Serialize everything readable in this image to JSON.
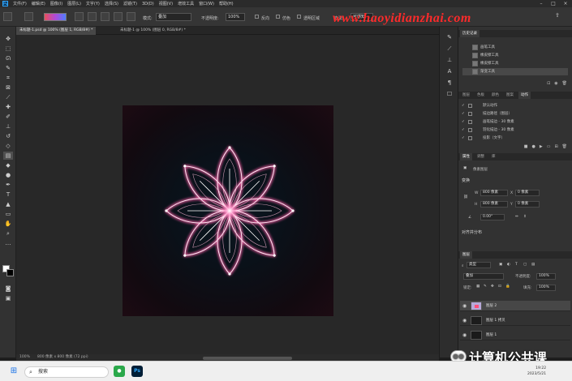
{
  "menu": {
    "logo": "Ps",
    "items": [
      "文件(F)",
      "编辑(E)",
      "图像(I)",
      "图层(L)",
      "文字(Y)",
      "选择(S)",
      "滤镜(T)",
      "3D(D)",
      "视图(V)",
      "增效工具",
      "窗口(W)",
      "帮助(H)"
    ]
  },
  "options": {
    "mode_label": "模式:",
    "mode_value": "叠加",
    "opacity_label": "不透明度:",
    "opacity_value": "100%",
    "reverse_label": "反向",
    "dither_label": "仿色",
    "transparency_label": "透明区域",
    "method_label": "方法:",
    "method_value": "可感知",
    "watermark": "www.haoyidianzhai.com"
  },
  "tabs": [
    {
      "label": "未标题-1.psd @ 100% (图层 1, RGB/8#) *",
      "active": true
    },
    {
      "label": "未标题-1 @ 100% (图层 0, RGB/8#) *",
      "active": false
    }
  ],
  "status": {
    "zoom": "100%",
    "doc": "800 像素 x 800 像素 (72 ppi)"
  },
  "history": {
    "tab": "历史记录",
    "rows": [
      "画笔工具",
      "橡皮擦工具",
      "橡皮擦工具",
      "渐变工具"
    ]
  },
  "actions": {
    "tabs": [
      "图层",
      "色板",
      "颜色",
      "图案",
      "动作"
    ],
    "rows": [
      "默认动作",
      "描边路径（图层）",
      "画笔描边 - 30 像素",
      "羽化描边 - 30 像素",
      "投影（文字）"
    ]
  },
  "properties": {
    "tabs": [
      "属性",
      "调整",
      "库"
    ],
    "type": "像素图层",
    "transform_head": "变换",
    "w_label": "W",
    "w_value": "800 像素",
    "h_label": "H",
    "h_value": "800 像素",
    "x_label": "X",
    "x_value": "0 像素",
    "y_label": "Y",
    "y_value": "0 像素",
    "angle": "0.00°",
    "align_head": "对齐并分布"
  },
  "layers": {
    "tab": "图层",
    "filter_label": "类型",
    "blend": "叠加",
    "opacity_label": "不透明度:",
    "opacity": "100%",
    "lock_label": "锁定:",
    "fill_label": "填充:",
    "fill": "100%",
    "rows": [
      "图层 2",
      "图层 1 拷贝",
      "图层 1"
    ]
  },
  "taskbar": {
    "search": "搜索",
    "time": "19:22",
    "date": "2023/5/21",
    "brand": "计算机公共课"
  },
  "colors": {
    "accent": "#31a8ff",
    "flower": "#ffe6f2",
    "glow": "#ff5fa8"
  }
}
